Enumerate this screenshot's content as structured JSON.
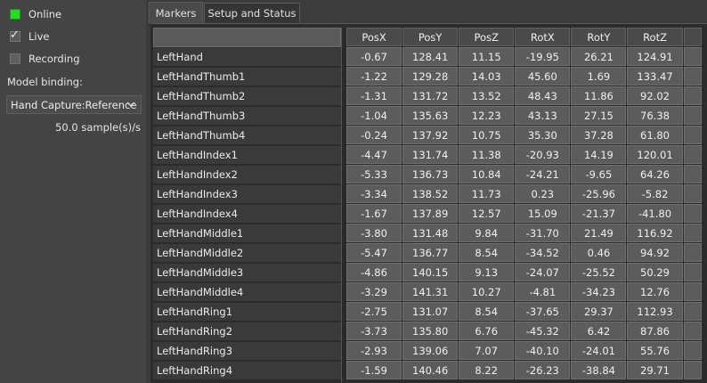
{
  "status": {
    "online_label": "Online",
    "live_label": "Live",
    "recording_label": "Recording",
    "online_color": "#2ed62e",
    "live_checked": true,
    "recording_checked": false
  },
  "model_binding": {
    "label": "Model binding:",
    "selected": "Hand Capture:Reference"
  },
  "sample_rate": "50.0 sample(s)/s",
  "tabs": [
    {
      "label": "Markers",
      "active": true
    },
    {
      "label": "Setup and Status",
      "active": false
    }
  ],
  "table": {
    "columns": [
      "PosX",
      "PosY",
      "PosZ",
      "RotX",
      "RotY",
      "RotZ"
    ],
    "rows": [
      {
        "name": "LeftHand",
        "values": [
          "-0.67",
          "128.41",
          "11.15",
          "-19.95",
          "26.21",
          "124.91"
        ]
      },
      {
        "name": "LeftHandThumb1",
        "values": [
          "-1.22",
          "129.28",
          "14.03",
          "45.60",
          "1.69",
          "133.47"
        ]
      },
      {
        "name": "LeftHandThumb2",
        "values": [
          "-1.31",
          "131.72",
          "13.52",
          "48.43",
          "11.86",
          "92.02"
        ]
      },
      {
        "name": "LeftHandThumb3",
        "values": [
          "-1.04",
          "135.63",
          "12.23",
          "43.13",
          "27.15",
          "76.38"
        ]
      },
      {
        "name": "LeftHandThumb4",
        "values": [
          "-0.24",
          "137.92",
          "10.75",
          "35.30",
          "37.28",
          "61.80"
        ]
      },
      {
        "name": "LeftHandIndex1",
        "values": [
          "-4.47",
          "131.74",
          "11.38",
          "-20.93",
          "14.19",
          "120.01"
        ]
      },
      {
        "name": "LeftHandIndex2",
        "values": [
          "-5.33",
          "136.73",
          "10.84",
          "-24.21",
          "-9.65",
          "64.26"
        ]
      },
      {
        "name": "LeftHandIndex3",
        "values": [
          "-3.34",
          "138.52",
          "11.73",
          "0.23",
          "-25.96",
          "-5.82"
        ]
      },
      {
        "name": "LeftHandIndex4",
        "values": [
          "-1.67",
          "137.89",
          "12.57",
          "15.09",
          "-21.37",
          "-41.80"
        ]
      },
      {
        "name": "LeftHandMiddle1",
        "values": [
          "-3.80",
          "131.48",
          "9.84",
          "-31.70",
          "21.49",
          "116.92"
        ]
      },
      {
        "name": "LeftHandMiddle2",
        "values": [
          "-5.47",
          "136.77",
          "8.54",
          "-34.52",
          "0.46",
          "94.92"
        ]
      },
      {
        "name": "LeftHandMiddle3",
        "values": [
          "-4.86",
          "140.15",
          "9.13",
          "-24.07",
          "-25.52",
          "50.29"
        ]
      },
      {
        "name": "LeftHandMiddle4",
        "values": [
          "-3.29",
          "141.31",
          "10.27",
          "-4.81",
          "-34.23",
          "12.76"
        ]
      },
      {
        "name": "LeftHandRing1",
        "values": [
          "-2.75",
          "131.07",
          "8.54",
          "-37.65",
          "29.37",
          "112.93"
        ]
      },
      {
        "name": "LeftHandRing2",
        "values": [
          "-3.73",
          "135.80",
          "6.76",
          "-45.32",
          "6.42",
          "87.86"
        ]
      },
      {
        "name": "LeftHandRing3",
        "values": [
          "-2.93",
          "139.06",
          "7.07",
          "-40.10",
          "-24.01",
          "55.76"
        ]
      },
      {
        "name": "LeftHandRing4",
        "values": [
          "-1.59",
          "140.46",
          "8.22",
          "-26.23",
          "-38.84",
          "29.71"
        ]
      }
    ]
  }
}
